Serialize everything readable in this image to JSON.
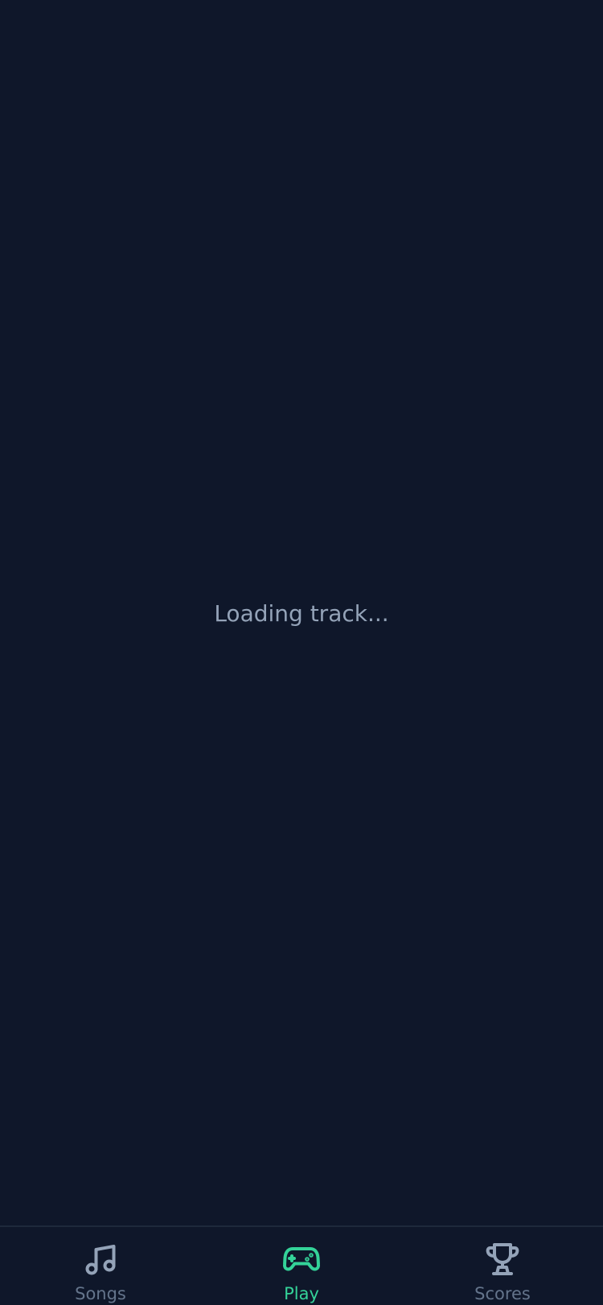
{
  "main": {
    "loading_text": "Loading track..."
  },
  "tabbar": {
    "tabs": [
      {
        "label": "Songs",
        "icon": "music-note-icon",
        "active": false
      },
      {
        "label": "Play",
        "icon": "gamepad-icon",
        "active": true
      },
      {
        "label": "Scores",
        "icon": "trophy-icon",
        "active": false
      }
    ]
  },
  "colors": {
    "background": "#0f172a",
    "text_muted": "#94a3b8",
    "icon_inactive": "#94a3b8",
    "accent": "#34d399",
    "divider": "#1e293b"
  }
}
